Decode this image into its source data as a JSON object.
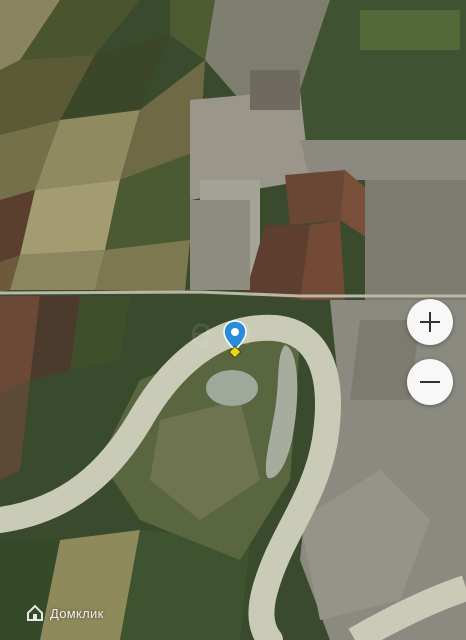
{
  "map": {
    "zoom_in_label": "+",
    "zoom_out_label": "−",
    "pin_color": "#2a8bd9",
    "pin_badge_color": "#f2d21a"
  },
  "watermark": {
    "brand_text": "Домклик"
  },
  "colors": {
    "river": "#c9cbb6",
    "field_dark": "#2e3a22",
    "field_light": "#7d7a55",
    "urban": "#8d8a7e",
    "soil": "#6a4634"
  }
}
